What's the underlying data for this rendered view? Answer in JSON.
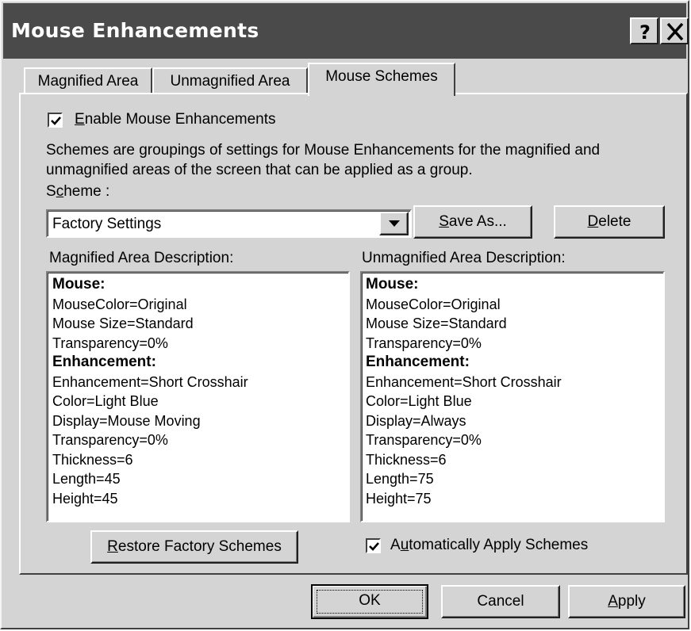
{
  "window": {
    "title": "Mouse Enhancements",
    "help_label": "?",
    "close_label": "X"
  },
  "tabs": [
    {
      "label": "Magnified Area",
      "active": false
    },
    {
      "label": "Unmagnified Area",
      "active": false
    },
    {
      "label": "Mouse Schemes",
      "active": true
    }
  ],
  "enable_checkbox": {
    "checked": true,
    "prefix": "",
    "mnemonic": "E",
    "suffix": "nable Mouse Enhancements"
  },
  "intro_text": [
    "Schemes are groupings of settings for Mouse Enhancements for the magnified and",
    "unmagnified areas of the screen that can be applied as a group."
  ],
  "scheme": {
    "label_prefix": "S",
    "label_mnemonic": "c",
    "label_suffix": "heme :",
    "selected": "Factory Settings"
  },
  "buttons": {
    "save_as": {
      "mnemonic": "S",
      "rest": "ave As..."
    },
    "delete": {
      "mnemonic": "D",
      "rest": "elete"
    },
    "restore": {
      "mnemonic": "R",
      "rest": "estore Factory Schemes"
    },
    "ok": "OK",
    "cancel": "Cancel",
    "apply": {
      "mnemonic": "A",
      "rest": "pply"
    }
  },
  "magnified": {
    "title": "Magnified Area Description:",
    "lines": [
      {
        "text": "Mouse:",
        "bold": true
      },
      {
        "text": "MouseColor=Original",
        "bold": false
      },
      {
        "text": "Mouse Size=Standard",
        "bold": false
      },
      {
        "text": "Transparency=0%",
        "bold": false
      },
      {
        "text": "Enhancement:",
        "bold": true
      },
      {
        "text": "Enhancement=Short Crosshair",
        "bold": false
      },
      {
        "text": "Color=Light Blue",
        "bold": false
      },
      {
        "text": "Display=Mouse Moving",
        "bold": false
      },
      {
        "text": "Transparency=0%",
        "bold": false
      },
      {
        "text": "Thickness=6",
        "bold": false
      },
      {
        "text": "Length=45",
        "bold": false
      },
      {
        "text": "Height=45",
        "bold": false
      }
    ]
  },
  "unmagnified": {
    "title": "Unmagnified Area Description:",
    "lines": [
      {
        "text": "Mouse:",
        "bold": true
      },
      {
        "text": "MouseColor=Original",
        "bold": false
      },
      {
        "text": "Mouse Size=Standard",
        "bold": false
      },
      {
        "text": "Transparency=0%",
        "bold": false
      },
      {
        "text": "Enhancement:",
        "bold": true
      },
      {
        "text": "Enhancement=Short Crosshair",
        "bold": false
      },
      {
        "text": "Color=Light Blue",
        "bold": false
      },
      {
        "text": "Display=Always",
        "bold": false
      },
      {
        "text": "Transparency=0%",
        "bold": false
      },
      {
        "text": "Thickness=6",
        "bold": false
      },
      {
        "text": "Length=75",
        "bold": false
      },
      {
        "text": "Height=75",
        "bold": false
      }
    ]
  },
  "auto_apply": {
    "checked": true,
    "prefix": "A",
    "mnemonic": "u",
    "suffix": "tomatically Apply Schemes"
  },
  "icons": {
    "help": "question-mark-icon",
    "close": "close-x-icon",
    "dropdown": "triangle-down-icon",
    "check": "checkmark-icon"
  }
}
